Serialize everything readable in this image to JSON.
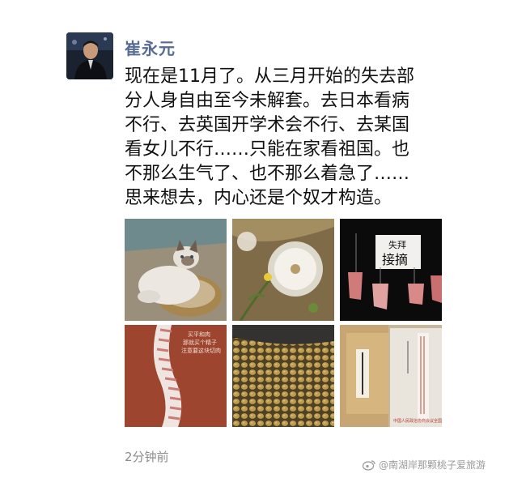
{
  "post": {
    "author": "崔永元",
    "content_lines": [
      "现在是11月了。从三月开始的失去部",
      "分人身自由至今未解套。去日本看病",
      "不行、去英国开学术会不行、去某国",
      "看女儿不行……只能在家看祖国。也",
      "不那么生气了、也不那么着急了……",
      "思来想去，内心还是个奴才构造。"
    ],
    "time": "2分钟前",
    "photos": [
      {
        "icon": "cat-photo"
      },
      {
        "icon": "dandelion-photo",
        "colors": [
          "#b89b6a",
          "#e8e4da"
        ]
      },
      {
        "icon": "hanging-meat-photo",
        "sign_text": "失拜 接摘"
      },
      {
        "icon": "ribs-photo",
        "caption_lines": [
          "买平和肉",
          "那就买个精子",
          "注意要这块切肉"
        ]
      },
      {
        "icon": "soybeans-photo"
      },
      {
        "icon": "envelopes-photo",
        "stamp_text": "中国人民政治协商会议全国委员会"
      }
    ]
  },
  "watermark": {
    "text": "@南湖岸那颗桃子爱旅游"
  }
}
